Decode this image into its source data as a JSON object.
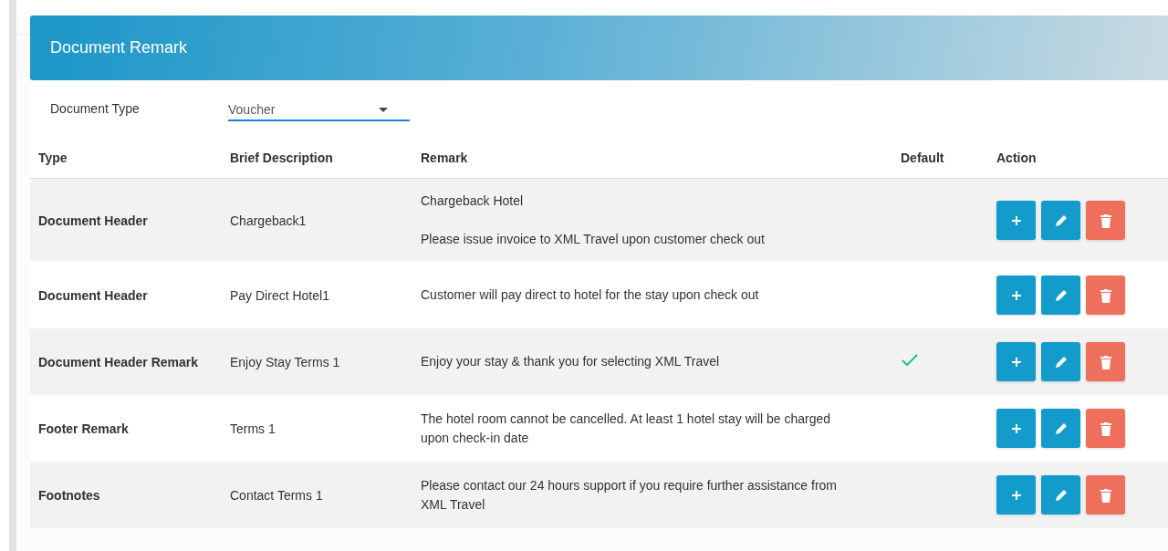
{
  "panel": {
    "title": "Document Remark"
  },
  "filter": {
    "label": "Document Type",
    "value": "Voucher"
  },
  "table": {
    "columns": [
      "Type",
      "Brief Description",
      "Remark",
      "Default",
      "Action"
    ],
    "rows": [
      {
        "type": "Document Header",
        "brief": "Chargeback1",
        "remark": [
          "Chargeback Hotel",
          "Please issue invoice to XML Travel upon customer check out"
        ],
        "default": false
      },
      {
        "type": "Document Header",
        "brief": "Pay Direct Hotel1",
        "remark": [
          "Customer will pay direct to hotel for the stay upon check out"
        ],
        "default": false
      },
      {
        "type": "Document Header Remark",
        "brief": "Enjoy Stay Terms 1",
        "remark": [
          "Enjoy your stay & thank you for selecting XML Travel"
        ],
        "default": true
      },
      {
        "type": "Footer Remark",
        "brief": "Terms 1",
        "remark": [
          "The hotel room cannot be cancelled. At least 1 hotel stay will be charged upon check-in date"
        ],
        "default": false
      },
      {
        "type": "Footnotes",
        "brief": "Contact Terms 1",
        "remark": [
          "Please contact our 24 hours support if you require further assistance from XML Travel"
        ],
        "default": false
      }
    ]
  }
}
